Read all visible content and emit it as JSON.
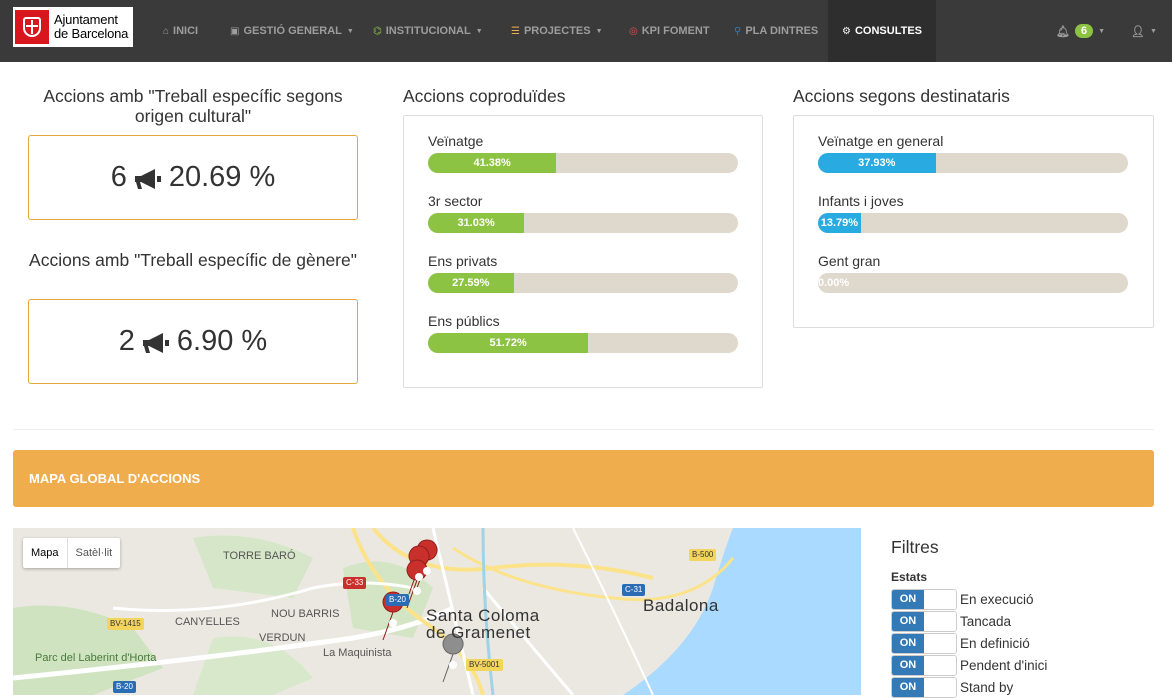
{
  "navbar": {
    "logo_line1": "Ajuntament",
    "logo_line2": "de Barcelona",
    "items": [
      {
        "label": "Inici",
        "icon": "⌂"
      },
      {
        "label": "Gestió General",
        "icon": "▣"
      },
      {
        "label": "Institucional",
        "icon": "⌬"
      },
      {
        "label": "Projectes",
        "icon": "☰"
      },
      {
        "label": "KPI Foment",
        "icon": "◎"
      },
      {
        "label": "Pla Dintres",
        "icon": "⚲"
      },
      {
        "label": "Consultes",
        "icon": "⚙"
      }
    ],
    "notifications_count": "6",
    "icon_colors": {
      "institucional": "#8dc343",
      "projectes": "#f0ad4e",
      "kpi": "#d9534f",
      "pla": "#337ab7"
    }
  },
  "stats": [
    {
      "title": "Accions amb \"Treball específic segons origen cultural\"",
      "count": "6",
      "percent": "20.69 %"
    },
    {
      "title": "Accions amb \"Treball específic de gènere\"",
      "count": "2",
      "percent": "6.90 %"
    }
  ],
  "coproduides": {
    "title": "Accions coproduïdes",
    "color": "#8dc343",
    "bars": [
      {
        "label": "Veïnatge",
        "value": 41.38,
        "text": "41.38%"
      },
      {
        "label": "3r sector",
        "value": 31.03,
        "text": "31.03%"
      },
      {
        "label": "Ens privats",
        "value": 27.59,
        "text": "27.59%"
      },
      {
        "label": "Ens públics",
        "value": 51.72,
        "text": "51.72%"
      }
    ]
  },
  "destinataris": {
    "title": "Accions segons destinataris",
    "color": "#29abe2",
    "bars": [
      {
        "label": "Veïnatge en general",
        "value": 37.93,
        "text": "37.93%"
      },
      {
        "label": "Infants i joves",
        "value": 13.79,
        "text": "13.79%"
      },
      {
        "label": "Gent gran",
        "value": 0,
        "text": "0.00%"
      }
    ]
  },
  "map_section": {
    "header": "MAPA GLOBAL D'ACCIONS",
    "controls": {
      "map": "Mapa",
      "satellite": "Satèl·lit"
    },
    "labels": [
      "TORRE BARÓ",
      "NOU BARRIS",
      "CANYELLES",
      "VERDUN",
      "Parc del Laberint d'Horta",
      "La Maquinista",
      "Santa Coloma",
      "de Gramenet",
      "Badalona"
    ],
    "roads": [
      "C-33",
      "B-20",
      "BV-1415",
      "C-31",
      "B-500",
      "BV-5001",
      "B-20"
    ]
  },
  "filters": {
    "title": "Filtres",
    "subtitle": "Estats",
    "on_label": "ON",
    "items": [
      "En execució",
      "Tancada",
      "En definició",
      "Pendent d'inici",
      "Stand by"
    ]
  }
}
